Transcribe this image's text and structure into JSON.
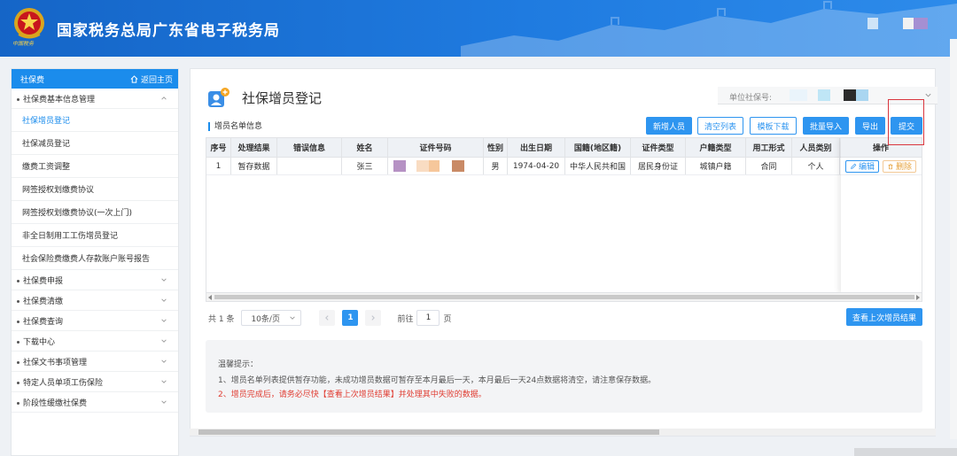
{
  "header": {
    "title": "国家税务总局广东省电子税务局",
    "emblem_text": "中国税务"
  },
  "sidebar": {
    "head_label": "社保费",
    "home_label": "返回主页",
    "groups": [
      {
        "label": "社保费基本信息管理",
        "expanded": true
      },
      {
        "label": "社保费申报"
      },
      {
        "label": "社保费清缴"
      },
      {
        "label": "社保费查询"
      },
      {
        "label": "下载中心"
      },
      {
        "label": "社保文书事项管理"
      },
      {
        "label": "特定人员单项工伤保险"
      },
      {
        "label": "阶段性缓缴社保费"
      }
    ],
    "sub_items": [
      {
        "label": "社保增员登记",
        "active": true
      },
      {
        "label": "社保减员登记"
      },
      {
        "label": "缴费工资调整"
      },
      {
        "label": "网签授权划缴费协议"
      },
      {
        "label": "网签授权划缴费协议(一次上门)"
      },
      {
        "label": "非全日制用工工伤增员登记"
      },
      {
        "label": "社会保险费缴费人存款账户账号报告"
      }
    ]
  },
  "page": {
    "title": "社保增员登记",
    "unit_label": "单位社保号:",
    "section_title": "增员名单信息"
  },
  "toolbar": {
    "add": "新增人员",
    "clear": "清空列表",
    "template": "模板下载",
    "import": "批量导入",
    "export": "导出",
    "submit": "提交"
  },
  "table": {
    "columns": [
      "序号",
      "处理结果",
      "错误信息",
      "姓名",
      "证件号码",
      "性别",
      "出生日期",
      "国籍(地区籍)",
      "证件类型",
      "户籍类型",
      "用工形式",
      "人员类别",
      "操作"
    ],
    "rows": [
      {
        "no": "1",
        "result": "暂存数据",
        "error": "",
        "name": "张三",
        "id": "",
        "gender": "男",
        "birth": "1974-04-20",
        "nationality": "中华人民共和国",
        "id_type": "居民身份证",
        "hukou": "城镇户籍",
        "employment": "合同",
        "category": "个人"
      }
    ],
    "op_edit": "编辑",
    "op_delete": "删除"
  },
  "pager": {
    "total": "共 1 条",
    "page_size": "10条/页",
    "current": "1",
    "goto_label": "前往",
    "goto_value": "1",
    "page_suffix": "页"
  },
  "last_result_button": "查看上次增员结果",
  "tips": {
    "title": "温馨提示：",
    "line1": "1、增员名单列表提供暂存功能，未成功增员数据可暂存至本月最后一天，本月最后一天24点数据将清空，请注意保存数据。",
    "line2": "2、增员完成后，请务必尽快【查看上次增员结果】并处理其中失败的数据。"
  },
  "colors": {
    "primary": "#2e95f0",
    "header": "#1565c7",
    "warning_red": "#e03c31",
    "highlight": "#d9363e"
  }
}
